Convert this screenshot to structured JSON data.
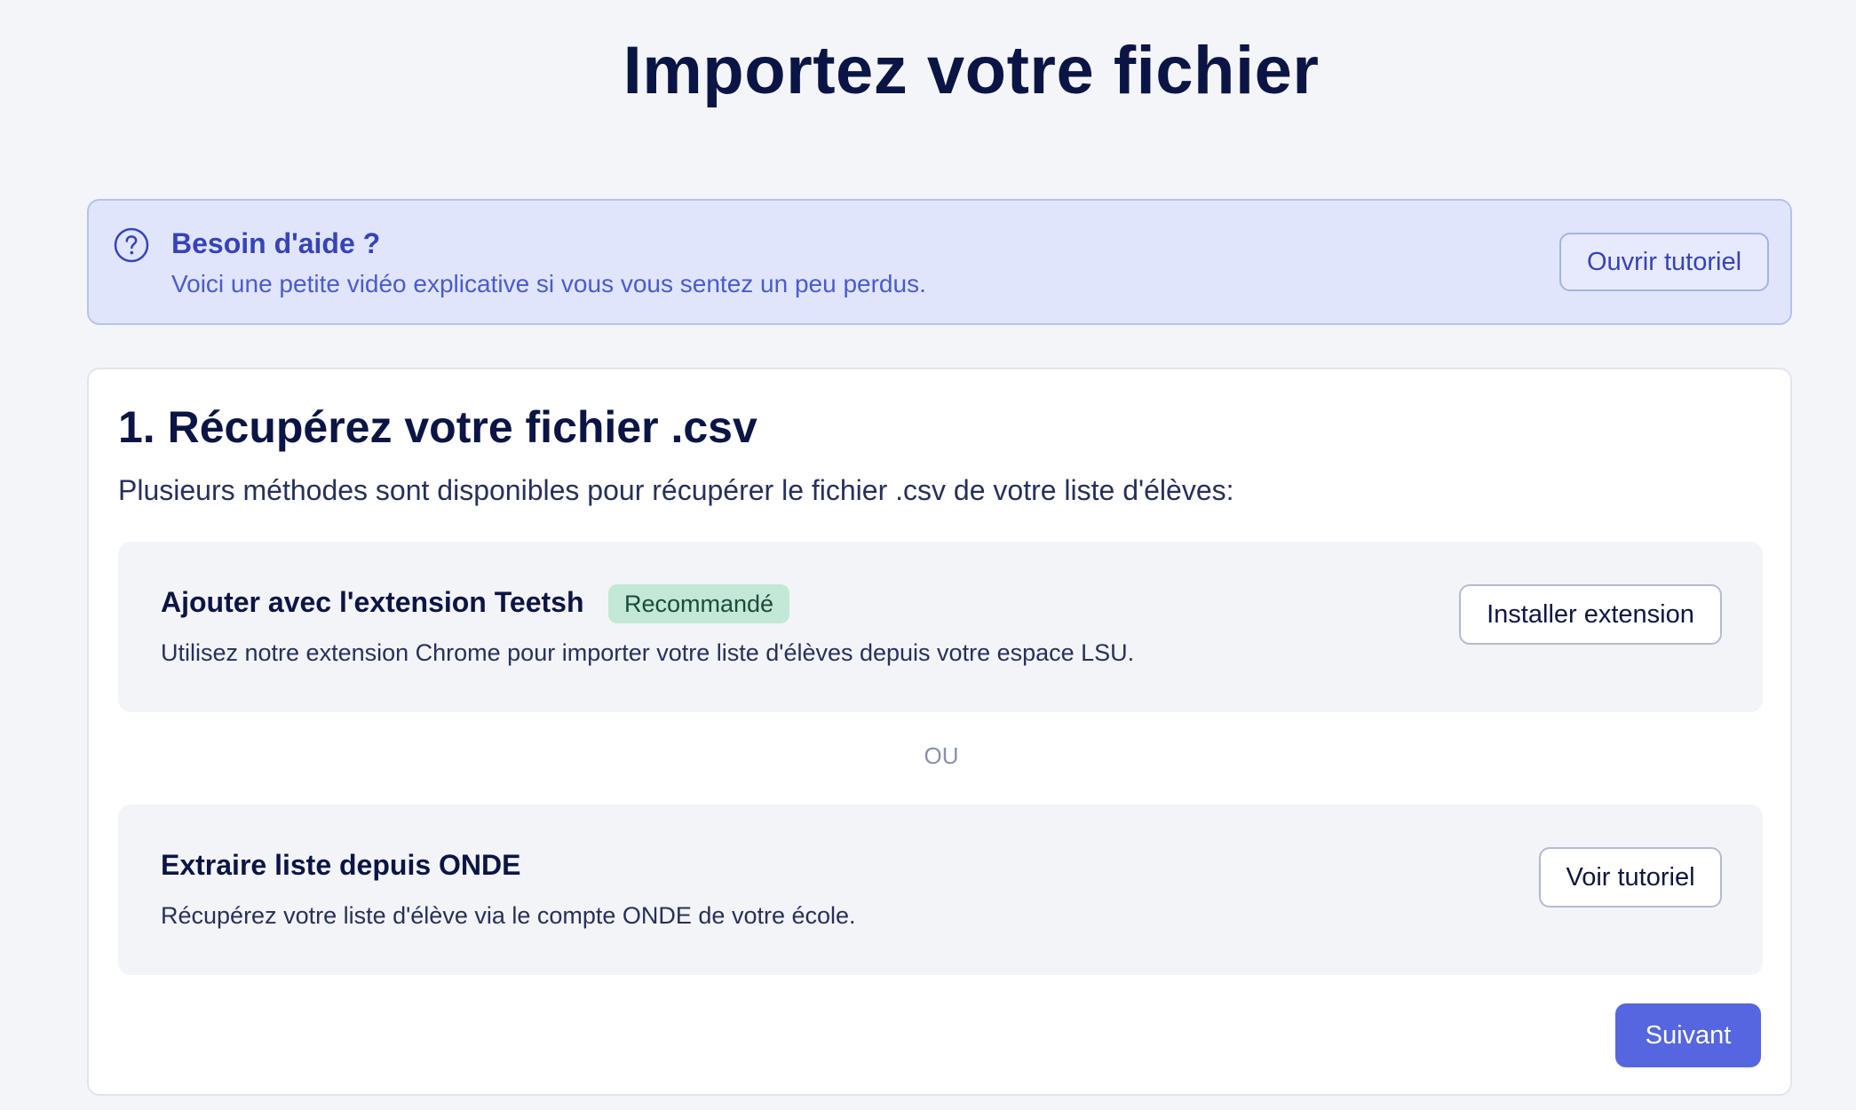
{
  "page": {
    "title": "Importez votre fichier"
  },
  "help": {
    "title": "Besoin d'aide ?",
    "description": "Voici une petite vidéo explicative si vous vous sentez un peu perdus.",
    "button_label": "Ouvrir tutoriel",
    "icon": "question-circle-icon"
  },
  "step": {
    "title": "1. Récupérez votre fichier .csv",
    "subtitle": "Plusieurs méthodes sont disponibles pour récupérer le fichier .csv de votre liste d'élèves:",
    "methods": [
      {
        "title": "Ajouter avec l'extension Teetsh",
        "badge": "Recommandé",
        "description": "Utilisez notre extension Chrome pour importer votre liste d'élèves depuis votre espace LSU.",
        "button_label": "Installer extension"
      },
      {
        "title": "Extraire liste depuis ONDE",
        "description": "Récupérez votre liste d'élève via le compte ONDE de votre école.",
        "button_label": "Voir tutoriel"
      }
    ],
    "separator": "OU",
    "next_label": "Suivant"
  },
  "colors": {
    "background": "#f4f5f9",
    "accent": "#5566e0",
    "help_bg": "#e0e5fb",
    "badge_bg": "#c3e8d7",
    "title": "#0b1545"
  }
}
